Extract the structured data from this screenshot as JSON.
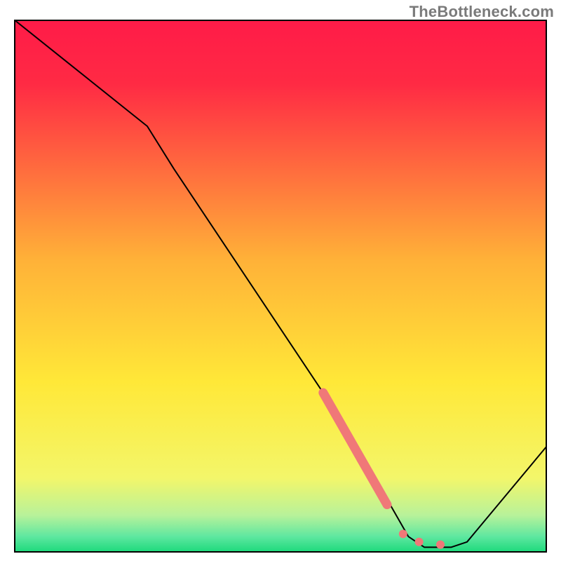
{
  "watermark_text": "TheBottleneck.com",
  "chart_data": {
    "type": "line",
    "title": "",
    "xlabel": "",
    "ylabel": "",
    "xlim": [
      0,
      100
    ],
    "ylim": [
      0,
      100
    ],
    "grid": false,
    "legend": false,
    "background_gradient_top": "#ff1b48",
    "background_gradient_mid": "#ffe838",
    "background_gradient_bottom": "#1ad97a",
    "series": [
      {
        "name": "bottleneck-curve",
        "color": "#000000",
        "stroke_width": 2,
        "x": [
          0,
          10,
          20,
          25,
          30,
          40,
          50,
          60,
          65,
          70,
          74,
          77,
          79,
          82,
          85,
          100
        ],
        "values": [
          100,
          92,
          84,
          80,
          72,
          57,
          42,
          27,
          19,
          10,
          3,
          1,
          1,
          1,
          2,
          20
        ]
      }
    ],
    "markers": [
      {
        "name": "highlight-segment",
        "shape": "thick-rounded-segment",
        "color": "#f07878",
        "stroke_width": 13,
        "x": [
          58,
          70
        ],
        "values": [
          30,
          9
        ]
      },
      {
        "name": "dot-1",
        "shape": "circle",
        "color": "#f07878",
        "radius": 6,
        "x": 73,
        "value": 3.5
      },
      {
        "name": "dot-2",
        "shape": "circle",
        "color": "#f07878",
        "radius": 6,
        "x": 76,
        "value": 2
      },
      {
        "name": "dot-3",
        "shape": "circle",
        "color": "#f07878",
        "radius": 6,
        "x": 80,
        "value": 1.5
      }
    ]
  }
}
